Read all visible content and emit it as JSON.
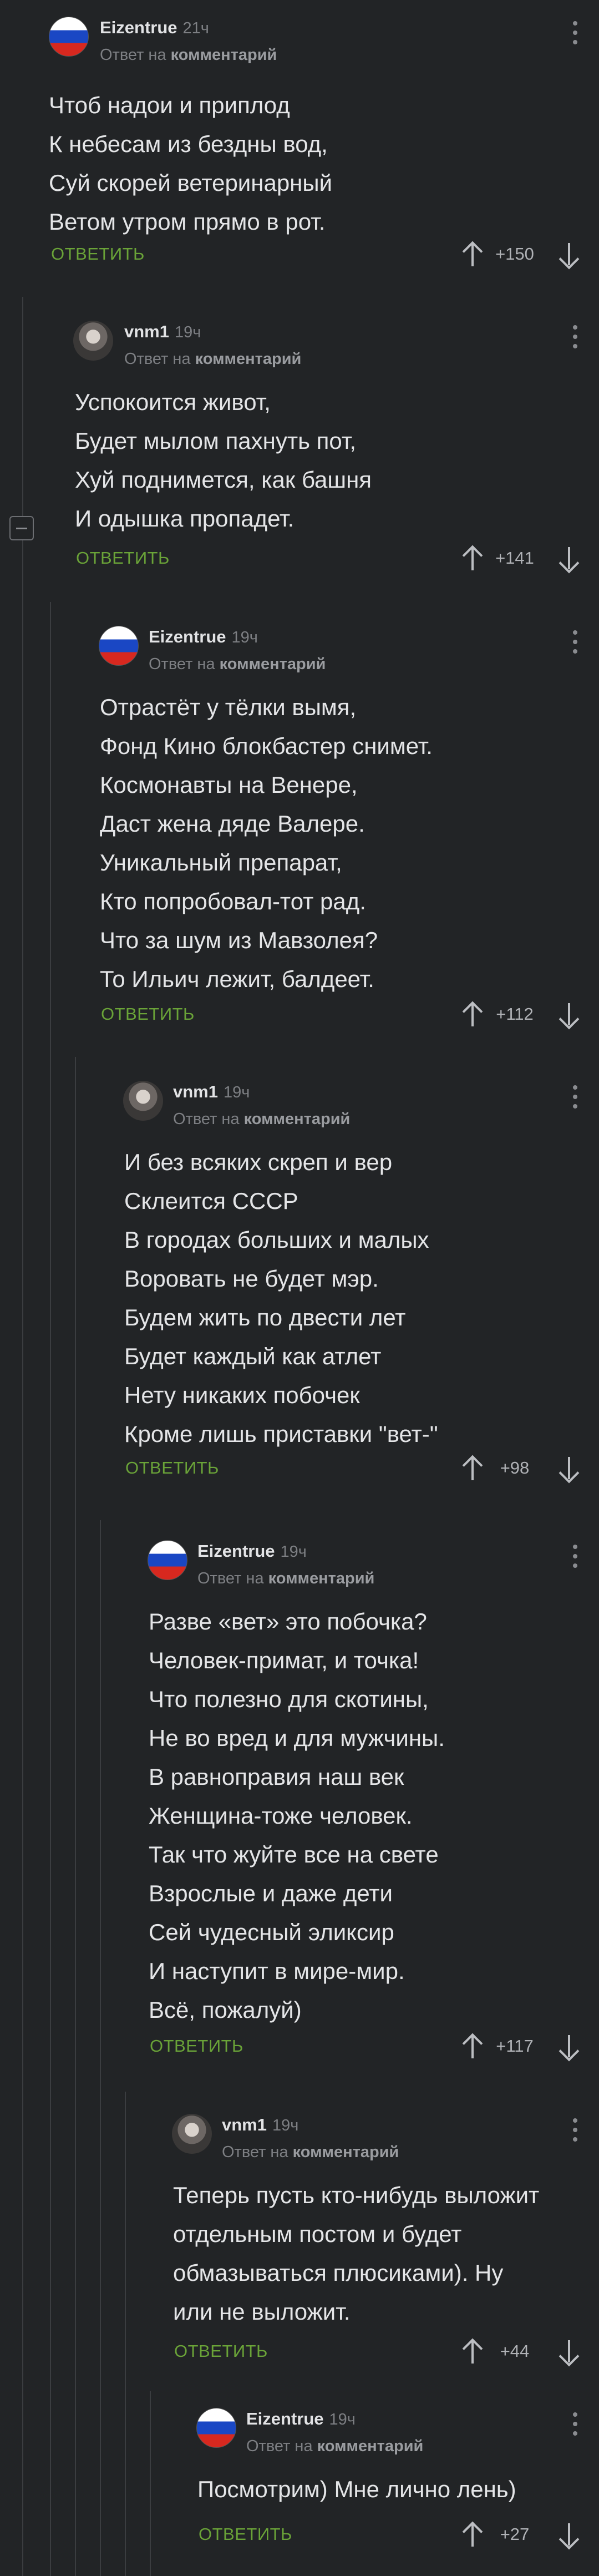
{
  "labels": {
    "reply_prefix": "Ответ на",
    "reply_target": "комментарий",
    "reply_button": "ОТВЕТИТЬ"
  },
  "comments": [
    {
      "author": "Eizentrue",
      "time": "21ч",
      "avatar": "flag-avatar",
      "rating": "+150",
      "text": "Чтоб надои и приплод\nК небесам из бездны вод,\nСуй скорей ветеринарный\nВетом утром прямо в рот."
    },
    {
      "author": "vnm1",
      "time": "19ч",
      "avatar": "face-avatar",
      "rating": "+141",
      "text": "Успокоится живот,\nБудет мылом пахнуть пот,\nХуй поднимется, как башня\nИ одышка пропадет."
    },
    {
      "author": "Eizentrue",
      "time": "19ч",
      "avatar": "flag-avatar",
      "rating": "+112",
      "text": "Отрастёт у тёлки вымя,\nФонд Кино блокбастер снимет.\nКосмонавты на Венере,\nДаст жена дяде Валере.\nУникальный препарат,\nКто попробовал-тот рад.\nЧто за шум из Мавзолея?\nТо Ильич лежит, балдеет."
    },
    {
      "author": "vnm1",
      "time": "19ч",
      "avatar": "face-avatar",
      "rating": "+98",
      "text": "И без всяких скреп и вер\nСклеится СССР\nВ городах больших и малых\nВоровать не будет мэр.\nБудем жить по двести лет\nБудет каждый как атлет\nНету никаких побочек\nКроме лишь приставки \"вет-\""
    },
    {
      "author": "Eizentrue",
      "time": "19ч",
      "avatar": "flag-avatar",
      "rating": "+117",
      "text": "Разве «вет» это побочка?\nЧеловек-примат, и точка!\nЧто полезно для скотины,\nНе во вред и для мужчины.\nВ равноправия наш век\nЖенщина-тоже человек.\nТак что жуйте все на свете\nВзрослые и даже дети\nСей чудесный эликсир\nИ наступит в мире-мир.\nВсё, пожалуй)"
    },
    {
      "author": "vnm1",
      "time": "19ч",
      "avatar": "face-avatar",
      "rating": "+44",
      "text": "Теперь пусть кто-нибудь выложит\nотдельным постом и будет\nобмазываться плюсиками). Ну\nили не выложит."
    },
    {
      "author": "Eizentrue",
      "time": "19ч",
      "avatar": "flag-avatar",
      "rating": "+27",
      "text": "Посмотрим) Мне лично лень)"
    }
  ]
}
